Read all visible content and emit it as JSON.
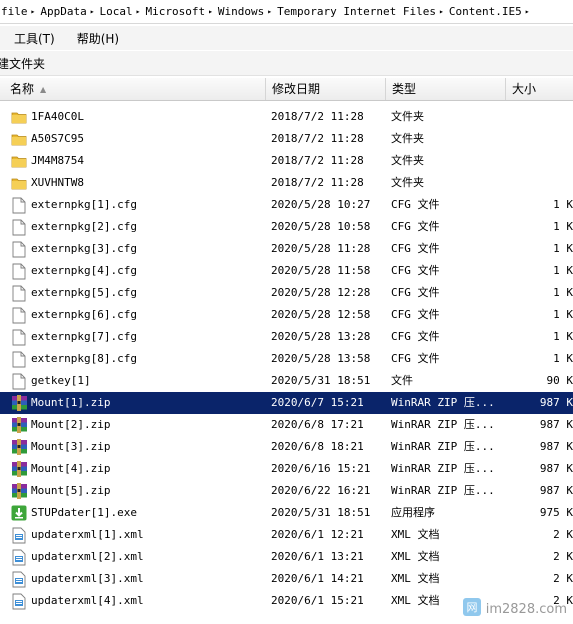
{
  "address": {
    "crumbs": [
      "file",
      "AppData",
      "Local",
      "Microsoft",
      "Windows",
      "Temporary Internet Files",
      "Content.IE5"
    ]
  },
  "menu": {
    "items": [
      "工具(T)",
      "帮助(H)"
    ]
  },
  "toolbar": {
    "new_folder": "建文件夹"
  },
  "columns": {
    "name": "名称",
    "date": "修改日期",
    "type": "类型",
    "size": "大小"
  },
  "files": [
    {
      "name": "1FA40C0L",
      "date": "2018/7/2 11:28",
      "type": "文件夹",
      "size": "",
      "icon": "folder-icon"
    },
    {
      "name": "A50S7C95",
      "date": "2018/7/2 11:28",
      "type": "文件夹",
      "size": "",
      "icon": "folder-icon"
    },
    {
      "name": "JM4M8754",
      "date": "2018/7/2 11:28",
      "type": "文件夹",
      "size": "",
      "icon": "folder-icon"
    },
    {
      "name": "XUVHNTW8",
      "date": "2018/7/2 11:28",
      "type": "文件夹",
      "size": "",
      "icon": "folder-icon"
    },
    {
      "name": "externpkg[1].cfg",
      "date": "2020/5/28 10:27",
      "type": "CFG 文件",
      "size": "1 K",
      "icon": "document-icon"
    },
    {
      "name": "externpkg[2].cfg",
      "date": "2020/5/28 10:58",
      "type": "CFG 文件",
      "size": "1 K",
      "icon": "document-icon"
    },
    {
      "name": "externpkg[3].cfg",
      "date": "2020/5/28 11:28",
      "type": "CFG 文件",
      "size": "1 K",
      "icon": "document-icon"
    },
    {
      "name": "externpkg[4].cfg",
      "date": "2020/5/28 11:58",
      "type": "CFG 文件",
      "size": "1 K",
      "icon": "document-icon"
    },
    {
      "name": "externpkg[5].cfg",
      "date": "2020/5/28 12:28",
      "type": "CFG 文件",
      "size": "1 K",
      "icon": "document-icon"
    },
    {
      "name": "externpkg[6].cfg",
      "date": "2020/5/28 12:58",
      "type": "CFG 文件",
      "size": "1 K",
      "icon": "document-icon"
    },
    {
      "name": "externpkg[7].cfg",
      "date": "2020/5/28 13:28",
      "type": "CFG 文件",
      "size": "1 K",
      "icon": "document-icon"
    },
    {
      "name": "externpkg[8].cfg",
      "date": "2020/5/28 13:58",
      "type": "CFG 文件",
      "size": "1 K",
      "icon": "document-icon"
    },
    {
      "name": "getkey[1]",
      "date": "2020/5/31 18:51",
      "type": "文件",
      "size": "90 K",
      "icon": "document-icon"
    },
    {
      "name": "Mount[1].zip",
      "date": "2020/6/7 15:21",
      "type": "WinRAR ZIP 压...",
      "size": "987 K",
      "icon": "winrar-archive-icon",
      "selected": true
    },
    {
      "name": "Mount[2].zip",
      "date": "2020/6/8 17:21",
      "type": "WinRAR ZIP 压...",
      "size": "987 K",
      "icon": "winrar-archive-icon"
    },
    {
      "name": "Mount[3].zip",
      "date": "2020/6/8 18:21",
      "type": "WinRAR ZIP 压...",
      "size": "987 K",
      "icon": "winrar-archive-icon"
    },
    {
      "name": "Mount[4].zip",
      "date": "2020/6/16 15:21",
      "type": "WinRAR ZIP 压...",
      "size": "987 K",
      "icon": "winrar-archive-icon"
    },
    {
      "name": "Mount[5].zip",
      "date": "2020/6/22 16:21",
      "type": "WinRAR ZIP 压...",
      "size": "987 K",
      "icon": "winrar-archive-icon"
    },
    {
      "name": "STUPdater[1].exe",
      "date": "2020/5/31 18:51",
      "type": "应用程序",
      "size": "975 K",
      "icon": "installer-icon"
    },
    {
      "name": "updaterxml[1].xml",
      "date": "2020/6/1 12:21",
      "type": "XML 文档",
      "size": "2 K",
      "icon": "xml-document-icon"
    },
    {
      "name": "updaterxml[2].xml",
      "date": "2020/6/1 13:21",
      "type": "XML 文档",
      "size": "2 K",
      "icon": "xml-document-icon"
    },
    {
      "name": "updaterxml[3].xml",
      "date": "2020/6/1 14:21",
      "type": "XML 文档",
      "size": "2 K",
      "icon": "xml-document-icon"
    },
    {
      "name": "updaterxml[4].xml",
      "date": "2020/6/1 15:21",
      "type": "XML 文档",
      "size": "2 K",
      "icon": "xml-document-icon"
    }
  ],
  "watermark": {
    "text": "im2828.com"
  },
  "colors": {
    "selection": "#0a246a",
    "folder": "#e8b830",
    "installer": "#3ea63a"
  }
}
